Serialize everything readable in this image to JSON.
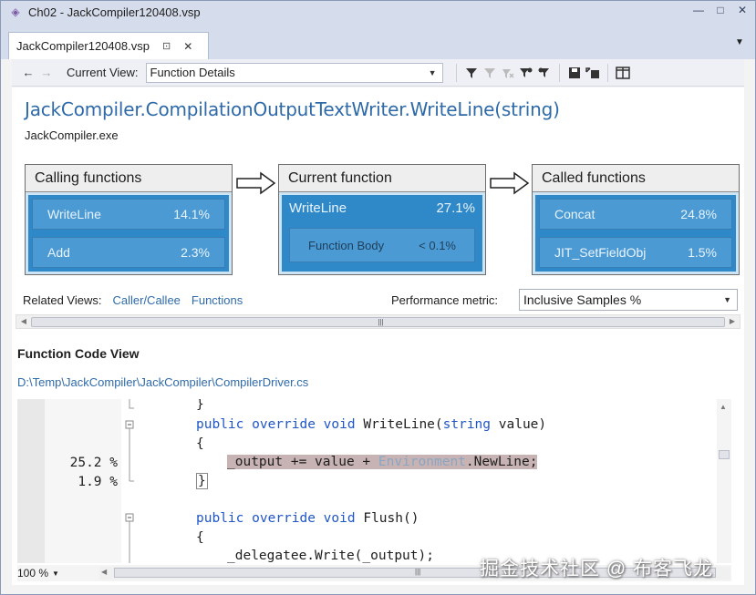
{
  "window": {
    "title": "Ch02 - JackCompiler120408.vsp"
  },
  "tab": {
    "label": "JackCompiler120408.vsp"
  },
  "toolbar": {
    "current_view_label": "Current View:",
    "current_view_value": "Function Details"
  },
  "function": {
    "name": "JackCompiler.CompilationOutputTextWriter.WriteLine(string)",
    "module": "JackCompiler.exe"
  },
  "calling": {
    "header": "Calling functions",
    "items": [
      {
        "name": "WriteLine",
        "value": "14.1%"
      },
      {
        "name": "Add",
        "value": "2.3%"
      }
    ]
  },
  "current": {
    "header": "Current function",
    "name": "WriteLine",
    "value": "27.1%",
    "body_label": "Function Body",
    "body_value": "< 0.1%"
  },
  "called": {
    "header": "Called functions",
    "items": [
      {
        "name": "Concat",
        "value": "24.8%"
      },
      {
        "name": "JIT_SetFieldObj",
        "value": "1.5%"
      }
    ]
  },
  "related": {
    "label": "Related Views:",
    "links": [
      "Caller/Callee",
      "Functions"
    ]
  },
  "performance": {
    "label": "Performance metric:",
    "value": "Inclusive Samples %"
  },
  "code_view": {
    "title": "Function Code View",
    "path": "D:\\Temp\\JackCompiler\\JackCompiler\\CompilerDriver.cs",
    "zoom": "100 %",
    "metrics": [
      "25.2 %",
      "1.9 %"
    ]
  },
  "watermark": "掘金技术社区 @ 布客飞龙",
  "colors": {
    "accent_blue": "#2f6aa8",
    "panel_blue": "#2f88c8",
    "highlight": "#c7b3b3"
  }
}
